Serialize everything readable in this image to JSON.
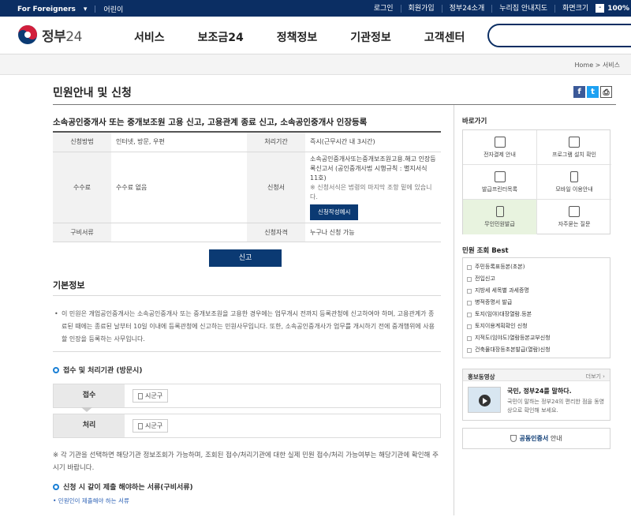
{
  "topbar": {
    "for_foreigners": "For Foreigners",
    "kids": "어린이",
    "links": [
      "로그인",
      "회원가입",
      "정부24소개",
      "누리집 안내지도",
      "화면크기"
    ],
    "zoom": "100%",
    "zoom_minus": "-"
  },
  "header": {
    "logo_text": "정부",
    "logo_num": "24",
    "nav": [
      "서비스",
      "보조금24",
      "정책정보",
      "기관정보",
      "고객센터"
    ]
  },
  "breadcrumb": "Home > 서비스",
  "page": {
    "title": "민원안내 및 신청",
    "share_fb": "f",
    "share_tw": "t",
    "share_print": "⎙",
    "service_title": "소속공인중개사 또는 중개보조원 고용 신고, 고용관계 종료 신고, 소속공인중개사 인장등록"
  },
  "info_table": {
    "r1_h1": "신청방법",
    "r1_v1": "인터넷, 방문, 우편",
    "r1_h2": "처리기간",
    "r1_v2": "즉시(근무시간 내 3시간)",
    "r2_h1": "수수료",
    "r2_v1": "수수료 없음",
    "r2_h2": "신청서",
    "r2_v2_line1": "소속공인중개사또는중개보조원고용.해고 인장등록신고서 (공인중개사법 시행규칙 : 별지서식 11호)",
    "r2_v2_line2": "※ 신청서식은 법령의 마지막 조항 밑에 있습니다.",
    "r2_btn": "신청작성예시",
    "r3_h1": "구비서류",
    "r3_v1": "",
    "r3_h2": "신청자격",
    "r3_v2": "누구나 신청 가능"
  },
  "apply_button": "신고",
  "basic": {
    "heading": "기본정보",
    "text": "이 민원은 개업공인중개사는 소속공인중개사 또는 중개보조원을 고용한 경우에는 업무개시 전까지 등록관청에 신고하여야 하며, 고용관계가 종료된 때에는 종료된 날부터 10일 이내에 등록관청에 신고하는 민원사무입니다. 또한, 소속공인중개사가 업무를 개시하기 전에 중개행위에 사용할 인장을 등록하는 사무입니다."
  },
  "org": {
    "heading": "접수 및 처리기관 (방문시)",
    "receive_label": "접수",
    "receive_value": "시군구",
    "process_label": "처리",
    "process_value": "시군구",
    "note": "※ 각 기관을 선택하면 해당기관 정보조회가 가능하며, 조회된 접수/처리기관에 대한 실제 민원 접수/처리 가능여부는 해당기관에 확인해 주시기 바랍니다."
  },
  "docs": {
    "heading": "신청 시 같이 제출 해야하는 서류(구비서류)",
    "link": "• 민원인이 제출해야 하는 서류"
  },
  "sidebar": {
    "quick_title": "바로가기",
    "quick": [
      "전자결제 안내",
      "프로그램 설치 확인",
      "발급프린터목록",
      "모바일 이용안내",
      "무인민원발급",
      "자주묻는 질문"
    ],
    "best_title": "민원 조회 Best",
    "best": [
      "주민등록표등본(초본)",
      "전입신고",
      "지방세 세목별 과세증명",
      "병적증명서 발급",
      "토지(임야)대장열람.등본",
      "토지이용계획확인 신청",
      "지적도(임야도)열람등본교부신청",
      "건축물대장등초본발급(열람)신청"
    ],
    "promo_title": "홍보동영상",
    "promo_more": "더보기 ›",
    "promo_headline": "국민, 정부24를 말하다.",
    "promo_desc": "국민이 말하는 정부24의 편리한 점을 동영상으로 확인해 보세요.",
    "cert_label": "공동인증서",
    "cert_suffix": "안내"
  }
}
